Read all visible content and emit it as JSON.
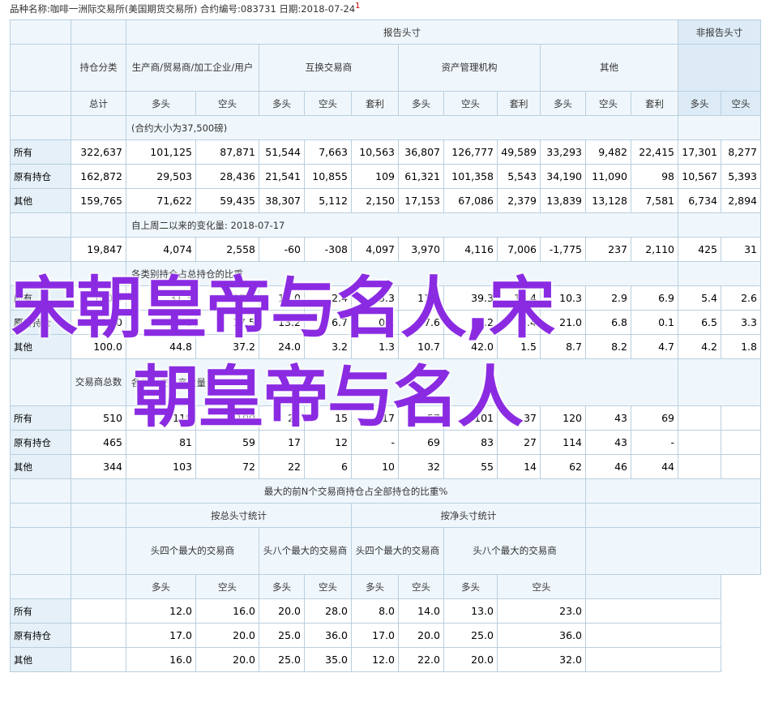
{
  "caption": {
    "text": "品种名称:咖啡一洲际交易所(美国期货交易所)   合约编号:083731   日期:2018-07-24",
    "sup": "1"
  },
  "headers": {
    "report": "报告头寸",
    "nonreport": "非报告头寸",
    "holding_class": "持仓分类",
    "producer": "生产商/贸易商/加工企业/用户",
    "swap": "互换交易商",
    "managed": "资产管理机构",
    "other": "其他",
    "total": "总计",
    "long": "多头",
    "short": "空头",
    "spread": "套利"
  },
  "section1": {
    "note": "(合约大小为37,500磅)",
    "rows": [
      {
        "label": "所有",
        "v": [
          "322,637",
          "101,125",
          "87,871",
          "51,544",
          "7,663",
          "10,563",
          "36,807",
          "126,777",
          "49,589",
          "33,293",
          "9,482",
          "22,415",
          "17,301",
          "8,277"
        ]
      },
      {
        "label": "原有持仓",
        "v": [
          "162,872",
          "29,503",
          "28,436",
          "21,541",
          "10,855",
          "109",
          "61,321",
          "101,358",
          "5,543",
          "34,190",
          "11,090",
          "98",
          "10,567",
          "5,393"
        ]
      },
      {
        "label": "其他",
        "v": [
          "159,765",
          "71,622",
          "59,435",
          "38,307",
          "5,112",
          "2,150",
          "17,153",
          "67,086",
          "2,379",
          "13,839",
          "13,128",
          "7,581",
          "6,734",
          "2,894"
        ]
      }
    ]
  },
  "section2": {
    "note": "自上周二以来的变化量: 2018-07-17",
    "values": [
      "19,847",
      "4,074",
      "2,558",
      "-60",
      "-308",
      "4,097",
      "3,970",
      "4,116",
      "7,006",
      "-1,775",
      "237",
      "2,110",
      "425",
      "31"
    ]
  },
  "section3": {
    "note": "各类别持仓占总持仓的比重",
    "rows": [
      {
        "label": "所有",
        "v": [
          "100.0",
          "31.3",
          "27.2",
          "16.0",
          "2.4",
          "3.3",
          "11.4",
          "39.3",
          "15.4",
          "10.3",
          "2.9",
          "6.9",
          "5.4",
          "2.6"
        ]
      },
      {
        "label": "原有持仓",
        "v": [
          "100.0",
          "18.1",
          "17.5",
          "13.2",
          "6.7",
          "0.1",
          "37.6",
          "62.2",
          "3.4",
          "21.0",
          "6.8",
          "0.1",
          "6.5",
          "3.3"
        ]
      },
      {
        "label": "其他",
        "v": [
          "100.0",
          "44.8",
          "37.2",
          "24.0",
          "3.2",
          "1.3",
          "10.7",
          "42.0",
          "1.5",
          "8.7",
          "8.2",
          "4.7",
          "4.2",
          "1.8"
        ]
      }
    ]
  },
  "section4": {
    "traders_total": "交易商总数",
    "note": "各类别交易商数量",
    "rows": [
      {
        "label": "所有",
        "v": [
          "510",
          "118",
          "100",
          "24",
          "15",
          "17",
          "57",
          "101",
          "37",
          "120",
          "43",
          "69",
          "",
          ""
        ]
      },
      {
        "label": "原有持仓",
        "v": [
          "465",
          "81",
          "59",
          "17",
          "12",
          "-",
          "69",
          "83",
          "27",
          "114",
          "43",
          "-",
          "",
          ""
        ]
      },
      {
        "label": "其他",
        "v": [
          "344",
          "103",
          "72",
          "22",
          "6",
          "10",
          "32",
          "55",
          "14",
          "62",
          "46",
          "44",
          "",
          ""
        ]
      }
    ]
  },
  "section5": {
    "title": "最大的前N个交易商持仓占全部持仓的比重%",
    "gross": "按总头寸统计",
    "net": "按净头寸统计",
    "top4": "头四个最大的交易商",
    "top8": "头八个最大的交易商",
    "rows": [
      {
        "label": "所有",
        "v": [
          "12.0",
          "16.0",
          "20.0",
          "28.0",
          "8.0",
          "14.0",
          "13.0",
          "23.0"
        ]
      },
      {
        "label": "原有持仓",
        "v": [
          "17.0",
          "20.0",
          "25.0",
          "36.0",
          "17.0",
          "20.0",
          "25.0",
          "36.0"
        ]
      },
      {
        "label": "其他",
        "v": [
          "16.0",
          "20.0",
          "25.0",
          "35.0",
          "12.0",
          "22.0",
          "20.0",
          "32.0"
        ]
      }
    ]
  },
  "watermark": {
    "line1": "宋朝皇帝与名人,宋",
    "line2": "朝皇帝与名人"
  }
}
